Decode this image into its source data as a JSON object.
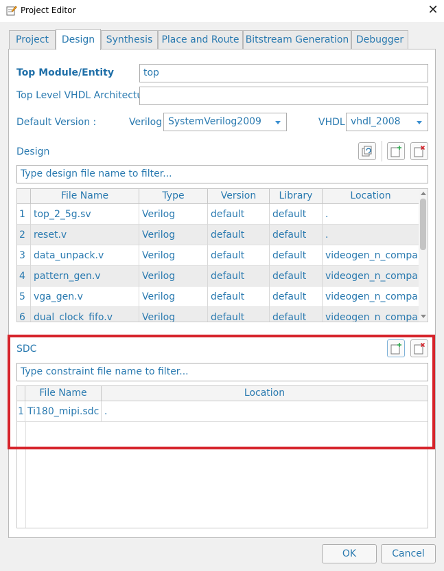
{
  "window": {
    "title": "Project Editor",
    "close_glyph": "✕"
  },
  "tabs": [
    {
      "label": "Project"
    },
    {
      "label": "Design",
      "active": true
    },
    {
      "label": "Synthesis"
    },
    {
      "label": "Place and Route"
    },
    {
      "label": "Bitstream Generation"
    },
    {
      "label": "Debugger"
    }
  ],
  "design": {
    "top_module_label": "Top Module/Entity",
    "top_module_value": "top",
    "top_vhdl_label": "Top Level VHDL Architecture",
    "top_vhdl_value": "",
    "default_version_label": "Default Version :",
    "verilog_label": "Verilog",
    "verilog_value": "SystemVerilog2009",
    "vhdl_label": "VHDL",
    "vhdl_value": "vhdl_2008",
    "section_label": "Design",
    "filter_placeholder": "Type design file name to filter...",
    "columns": [
      "File Name",
      "Type",
      "Version",
      "Library",
      "Location"
    ],
    "rows": [
      {
        "num": "1",
        "file": "top_2_5g.sv",
        "type": "Verilog",
        "version": "default",
        "library": "default",
        "location": "."
      },
      {
        "num": "2",
        "file": "reset.v",
        "type": "Verilog",
        "version": "default",
        "library": "default",
        "location": "."
      },
      {
        "num": "3",
        "file": "data_unpack.v",
        "type": "Verilog",
        "version": "default",
        "library": "default",
        "location": "videogen_n_comparator"
      },
      {
        "num": "4",
        "file": "pattern_gen.v",
        "type": "Verilog",
        "version": "default",
        "library": "default",
        "location": "videogen_n_comparator"
      },
      {
        "num": "5",
        "file": "vga_gen.v",
        "type": "Verilog",
        "version": "default",
        "library": "default",
        "location": "videogen_n_comparator"
      },
      {
        "num": "6",
        "file": "dual_clock_fifo.v",
        "type": "Verilog",
        "version": "default",
        "library": "default",
        "location": "videogen_n_comparator"
      }
    ]
  },
  "sdc": {
    "section_label": "SDC",
    "filter_placeholder": "Type constraint file name to filter...",
    "columns": [
      "File Name",
      "Location"
    ],
    "rows": [
      {
        "num": "1",
        "file": "Ti180_mipi.sdc",
        "location": "."
      }
    ]
  },
  "buttons": {
    "ok": "OK",
    "cancel": "Cancel"
  },
  "colors": {
    "accent_text": "#2a7ab0",
    "highlight": "#d6232a",
    "add_icon": "#2fa84f",
    "remove_icon": "#d6232a"
  },
  "icons": [
    "app-icon",
    "close-icon",
    "refresh-icon",
    "add-file-icon",
    "remove-file-icon",
    "chevron-down-icon"
  ]
}
